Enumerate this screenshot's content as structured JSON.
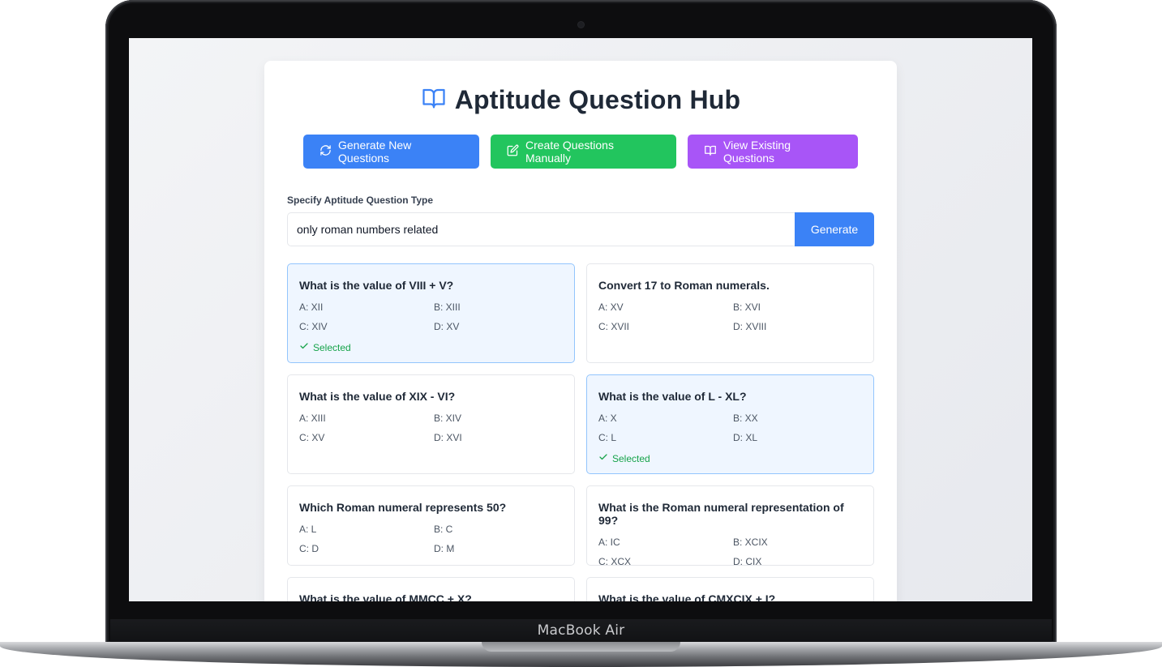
{
  "device": {
    "brand": "MacBook Air"
  },
  "app": {
    "title": "Aptitude Question Hub",
    "actions": [
      {
        "label": "Generate New Questions",
        "icon": "refresh-icon",
        "color": "#3b82f6"
      },
      {
        "label": "Create Questions Manually",
        "icon": "edit-icon",
        "color": "#22c55e"
      },
      {
        "label": "View Existing Questions",
        "icon": "book-icon",
        "color": "#a855f7"
      }
    ],
    "field_label": "Specify Aptitude Question Type",
    "input_value": "only roman numbers related",
    "generate_label": "Generate",
    "selected_label": "Selected",
    "questions": [
      {
        "question": "What is the value of VIII + V?",
        "options": [
          "A: XII",
          "B: XIII",
          "C: XIV",
          "D: XV"
        ],
        "selected": true
      },
      {
        "question": "Convert 17 to Roman numerals.",
        "options": [
          "A: XV",
          "B: XVI",
          "C: XVII",
          "D: XVIII"
        ],
        "selected": false
      },
      {
        "question": "What is the value of XIX - VI?",
        "options": [
          "A: XIII",
          "B: XIV",
          "C: XV",
          "D: XVI"
        ],
        "selected": false
      },
      {
        "question": "What is the value of L - XL?",
        "options": [
          "A: X",
          "B: XX",
          "C: L",
          "D: XL"
        ],
        "selected": true
      },
      {
        "question": "Which Roman numeral represents 50?",
        "options": [
          "A: L",
          "B: C",
          "C: D",
          "D: M"
        ],
        "selected": false
      },
      {
        "question": "What is the Roman numeral representation of 99?",
        "options": [
          "A: IC",
          "B: XCIX",
          "C: XCX",
          "D: CIX"
        ],
        "selected": false
      },
      {
        "question": "What is the value of MMCC + X?",
        "options": [],
        "selected": false
      },
      {
        "question": "What is the value of CMXCIX + I?",
        "options": [],
        "selected": false
      }
    ]
  }
}
